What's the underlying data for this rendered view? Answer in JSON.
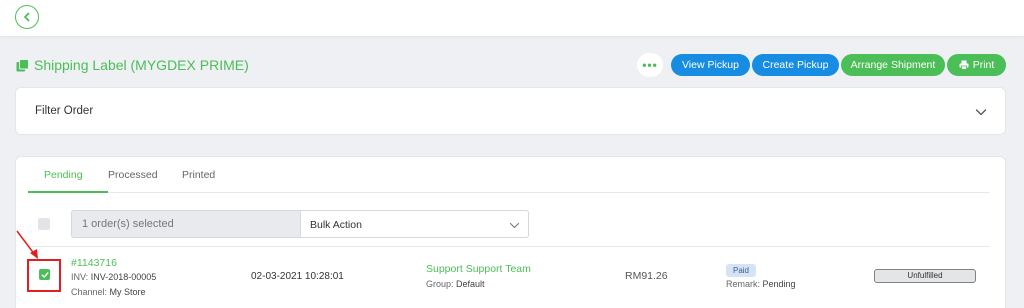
{
  "page": {
    "title": "Shipping Label (MYGDEX PRIME)",
    "more_label": "•••"
  },
  "actions": {
    "view_pickup": "View Pickup",
    "create_pickup": "Create Pickup",
    "arrange_shipment": "Arrange Shipment",
    "print": "Print"
  },
  "filter": {
    "label": "Filter Order"
  },
  "tabs": [
    {
      "label": "Pending",
      "active": true
    },
    {
      "label": "Processed",
      "active": false
    },
    {
      "label": "Printed",
      "active": false
    }
  ],
  "bulk": {
    "selected_text": "1 order(s) selected",
    "action_label": "Bulk Action"
  },
  "order": {
    "id": "#1143716",
    "inv_label": "INV:",
    "inv_value": "INV-2018-00005",
    "channel_label": "Channel:",
    "channel_value": "My Store",
    "date": "02-03-2021 10:28:01",
    "team": "Support Support Team",
    "group_label": "Group:",
    "group_value": "Default",
    "amount": "RM91.26",
    "payment_badge": "Paid",
    "remark_label": "Remark:",
    "remark_value": "Pending",
    "fulfillment": "Unfulfilled",
    "selected": true
  },
  "colors": {
    "brand_green": "#4cbe57",
    "action_blue": "#168de2",
    "highlight_red": "#e02020"
  }
}
